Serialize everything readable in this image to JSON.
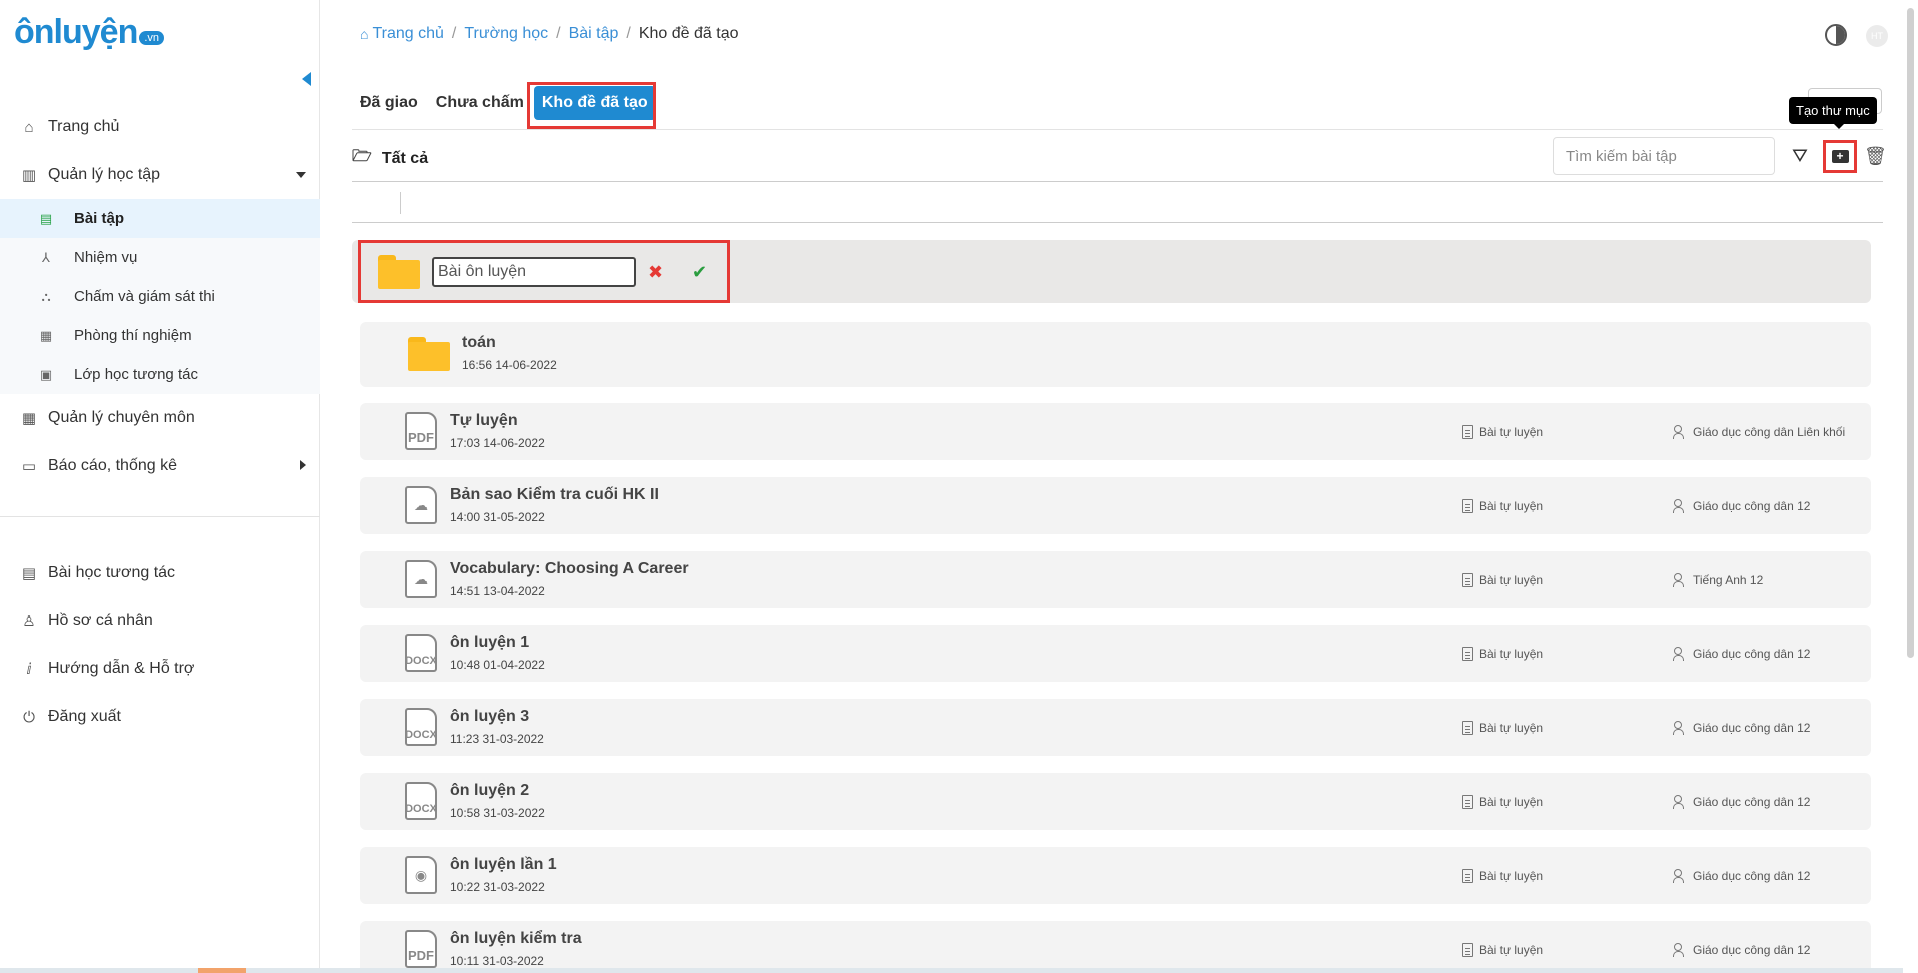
{
  "brand": {
    "name_on": "ôn",
    "name_rest": "luyện",
    "suffix": ".vn"
  },
  "sidebar": {
    "items": [
      {
        "label": "Trang chủ",
        "icon": "home-icon"
      },
      {
        "label": "Quản lý học tập",
        "icon": "school-icon"
      }
    ],
    "sub_items": [
      {
        "label": "Bài tập",
        "icon": "clipboard-icon"
      },
      {
        "label": "Nhiệm vụ",
        "icon": "compass-icon"
      },
      {
        "label": "Chấm và giám sát thi",
        "icon": "exam-icon"
      },
      {
        "label": "Phòng thí nghiệm",
        "icon": "lab-icon"
      },
      {
        "label": "Lớp học tương tác",
        "icon": "monitor-icon"
      }
    ],
    "items_after": [
      {
        "label": "Quản lý chuyên môn",
        "icon": "calendar-icon"
      },
      {
        "label": "Báo cáo, thống kê",
        "icon": "report-icon"
      }
    ],
    "items_bottom": [
      {
        "label": "Bài học tương tác",
        "icon": "lesson-icon"
      },
      {
        "label": "Hồ sơ cá nhân",
        "icon": "user-icon"
      },
      {
        "label": "Hướng dẫn & Hỗ trợ",
        "icon": "info-icon"
      },
      {
        "label": "Đăng xuất",
        "icon": "power-icon"
      }
    ]
  },
  "breadcrumb": [
    "Trang chủ",
    "Trường học",
    "Bài tập",
    "Kho đề đã tạo"
  ],
  "header": {
    "avatar_text": "HT"
  },
  "tabs": [
    "Đã giao",
    "Chưa chấm",
    "Kho đề đã tạo"
  ],
  "toolbar": {
    "folder_label": "Tất cả",
    "search_placeholder": "Tìm kiếm bài tập",
    "tooltip": "Tạo thư mục"
  },
  "new_folder": {
    "value": "Bài ôn luyện"
  },
  "folders": [
    {
      "name": "toán",
      "date": "16:56 14-06-2022"
    }
  ],
  "files": [
    {
      "title": "Tự luyện",
      "date": "17:03 14-06-2022",
      "filetype": "PDF",
      "type": "Bài tự luyện",
      "subject": "Giáo dục công dân Liên khối"
    },
    {
      "title": "Bản sao Kiểm tra cuối HK II",
      "date": "14:00 31-05-2022",
      "filetype": "cloud",
      "type": "Bài tự luyện",
      "subject": "Giáo dục công dân 12"
    },
    {
      "title": "Vocabulary: Choosing A Career",
      "date": "14:51 13-04-2022",
      "filetype": "cloud",
      "type": "Bài tự luyện",
      "subject": "Tiếng Anh 12"
    },
    {
      "title": "ôn luyện 1",
      "date": "10:48 01-04-2022",
      "filetype": "DOCX",
      "type": "Bài tự luyện",
      "subject": "Giáo dục công dân 12"
    },
    {
      "title": "ôn luyện 3",
      "date": "11:23 31-03-2022",
      "filetype": "DOCX",
      "type": "Bài tự luyện",
      "subject": "Giáo dục công dân 12"
    },
    {
      "title": "ôn luyện 2",
      "date": "10:58 31-03-2022",
      "filetype": "DOCX",
      "type": "Bài tự luyện",
      "subject": "Giáo dục công dân 12"
    },
    {
      "title": "ôn luyện lần 1",
      "date": "10:22 31-03-2022",
      "filetype": "camera",
      "type": "Bài tự luyện",
      "subject": "Giáo dục công dân 12"
    },
    {
      "title": "ôn luyện kiểm tra",
      "date": "10:11 31-03-2022",
      "filetype": "PDF",
      "type": "Bài tự luyện",
      "subject": "Giáo dục công dân 12"
    }
  ],
  "colors": {
    "accent": "#1f8ad1",
    "highlight": "#e53935",
    "folder": "#fdc02a"
  }
}
